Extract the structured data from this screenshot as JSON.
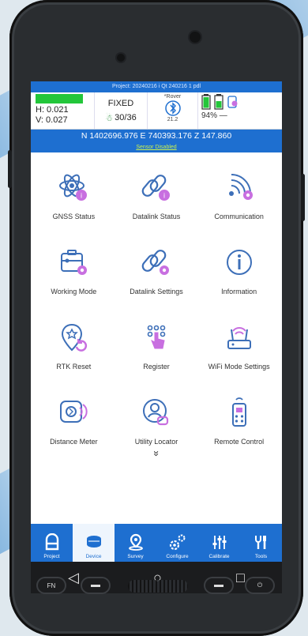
{
  "project_bar": "Project: 20240216 i Qt 240216 1 pdl",
  "status": {
    "h": "H: 0.021",
    "v": "V: 0.027",
    "fix": "FIXED",
    "sats": "30/36",
    "rover": "*Rover",
    "link": "21.2",
    "battery_pct": "94%",
    "battery_suffix": "—"
  },
  "coords": "N 1402696.976   E 740393.176   Z 147.860",
  "sensor": "Sensor Disabled",
  "tiles": [
    {
      "label": "GNSS Status",
      "icon": "gnss-status-icon"
    },
    {
      "label": "Datalink Status",
      "icon": "datalink-status-icon"
    },
    {
      "label": "Communication",
      "icon": "communication-icon"
    },
    {
      "label": "Working Mode",
      "icon": "working-mode-icon"
    },
    {
      "label": "Datalink Settings",
      "icon": "datalink-settings-icon"
    },
    {
      "label": "Information",
      "icon": "information-icon"
    },
    {
      "label": "RTK Reset",
      "icon": "rtk-reset-icon"
    },
    {
      "label": "Register",
      "icon": "register-icon"
    },
    {
      "label": "WiFi Mode Settings",
      "icon": "wifi-mode-icon"
    },
    {
      "label": "Distance Meter",
      "icon": "distance-meter-icon"
    },
    {
      "label": "Utility Locator",
      "icon": "utility-locator-icon"
    },
    {
      "label": "Remote Control",
      "icon": "remote-control-icon"
    }
  ],
  "more_glyph": "»",
  "nav": [
    {
      "label": "Project",
      "icon": "project-icon",
      "active": false
    },
    {
      "label": "Device",
      "icon": "device-icon",
      "active": true
    },
    {
      "label": "Survey",
      "icon": "survey-icon",
      "active": false
    },
    {
      "label": "Configure",
      "icon": "configure-icon",
      "active": false
    },
    {
      "label": "Calibrate",
      "icon": "calibrate-icon",
      "active": false
    },
    {
      "label": "Tools",
      "icon": "tools-icon",
      "active": false
    }
  ],
  "android": {
    "back": "◁",
    "home": "○",
    "recents": "□"
  },
  "hw_keys": {
    "fn": "FN",
    "power": "⏻"
  },
  "colors": {
    "primary": "#1e6fd0",
    "accent_pink": "#c86fe0",
    "icon_blue": "#3d6fb8",
    "fixed_green": "#23c63a"
  }
}
